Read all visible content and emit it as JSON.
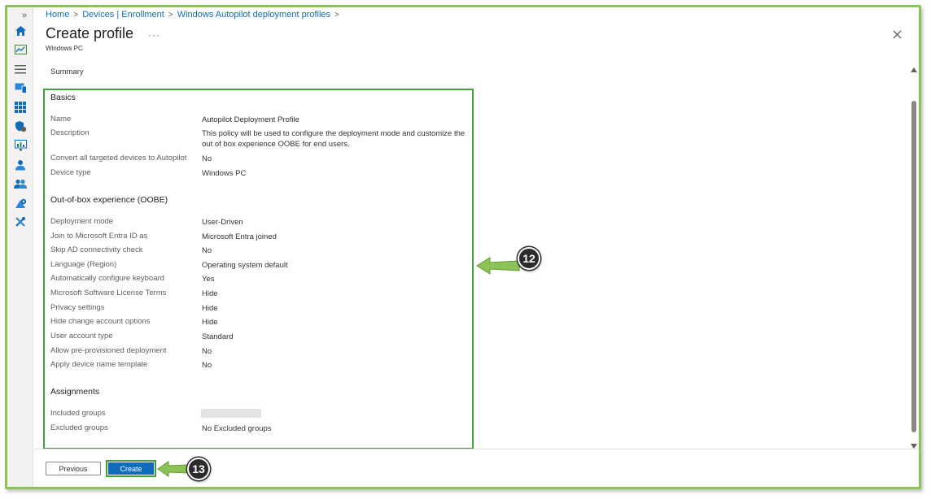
{
  "breadcrumb": {
    "items": [
      "Home",
      "Devices | Enrollment",
      "Windows Autopilot deployment profiles"
    ],
    "separator": ">"
  },
  "header": {
    "title": "Create profile",
    "more": "···",
    "subtitle": "Windows PC"
  },
  "summary_label": "Summary",
  "basics": {
    "title": "Basics",
    "rows": [
      {
        "label": "Name",
        "value": "Autopilot Deployment Profile"
      },
      {
        "label": "Description",
        "value": "This policy will be used to configure the deployment mode and customize the out of box experience OOBE for end users."
      },
      {
        "label": "Convert all targeted devices to Autopilot",
        "value": "No"
      },
      {
        "label": "Device type",
        "value": "Windows PC"
      }
    ]
  },
  "oobe": {
    "title": "Out-of-box experience (OOBE)",
    "rows": [
      {
        "label": "Deployment mode",
        "value": "User-Driven"
      },
      {
        "label": "Join to Microsoft Entra ID as",
        "value": "Microsoft Entra joined"
      },
      {
        "label": "Skip AD connectivity check",
        "value": "No"
      },
      {
        "label": "Language (Region)",
        "value": "Operating system default"
      },
      {
        "label": "Automatically configure keyboard",
        "value": "Yes"
      },
      {
        "label": "Microsoft Software License Terms",
        "value": "Hide"
      },
      {
        "label": "Privacy settings",
        "value": "Hide"
      },
      {
        "label": "Hide change account options",
        "value": "Hide"
      },
      {
        "label": "User account type",
        "value": "Standard"
      },
      {
        "label": "Allow pre-provisioned deployment",
        "value": "No"
      },
      {
        "label": "Apply device name template",
        "value": "No"
      }
    ]
  },
  "assignments": {
    "title": "Assignments",
    "rows": [
      {
        "label": "Included groups",
        "value": ""
      },
      {
        "label": "Excluded groups",
        "value": "No Excluded groups"
      }
    ]
  },
  "footer": {
    "previous_label": "Previous",
    "create_label": "Create"
  },
  "callouts": [
    "12",
    "13"
  ],
  "colors": {
    "accent": "#0f6cbd",
    "highlight": "#3fa13a",
    "arrow": "#8dc257",
    "frame": "#8dc257"
  }
}
